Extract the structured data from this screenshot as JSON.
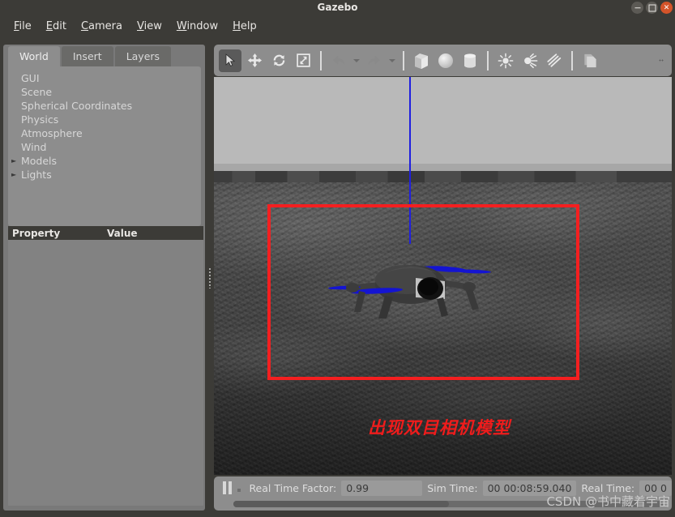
{
  "window": {
    "title": "Gazebo",
    "controls": [
      {
        "name": "minimize-button",
        "icon": "minimize-icon"
      },
      {
        "name": "maximize-button",
        "icon": "maximize-icon"
      },
      {
        "name": "close-button",
        "icon": "close-icon"
      }
    ]
  },
  "menubar": {
    "items": [
      {
        "label": "File",
        "mnemonic": "F",
        "rest": "ile"
      },
      {
        "label": "Edit",
        "mnemonic": "E",
        "rest": "dit"
      },
      {
        "label": "Camera",
        "mnemonic": "C",
        "rest": "amera"
      },
      {
        "label": "View",
        "mnemonic": "V",
        "rest": "iew"
      },
      {
        "label": "Window",
        "mnemonic": "W",
        "rest": "indow"
      },
      {
        "label": "Help",
        "mnemonic": "H",
        "rest": "elp"
      }
    ]
  },
  "left_panel": {
    "tabs": [
      {
        "label": "World",
        "active": true
      },
      {
        "label": "Insert",
        "active": false
      },
      {
        "label": "Layers",
        "active": false
      }
    ],
    "tree": [
      {
        "label": "GUI",
        "expandable": false
      },
      {
        "label": "Scene",
        "expandable": false
      },
      {
        "label": "Spherical Coordinates",
        "expandable": false
      },
      {
        "label": "Physics",
        "expandable": false
      },
      {
        "label": "Atmosphere",
        "expandable": false
      },
      {
        "label": "Wind",
        "expandable": false
      },
      {
        "label": "Models",
        "expandable": true
      },
      {
        "label": "Lights",
        "expandable": true
      }
    ],
    "property_table": {
      "columns": [
        "Property",
        "Value"
      ],
      "rows": []
    }
  },
  "toolbar": {
    "tools": [
      {
        "name": "select-tool",
        "icon": "cursor-arrow-icon",
        "active": true
      },
      {
        "name": "translate-tool",
        "icon": "move-arrows-icon",
        "active": false
      },
      {
        "name": "rotate-tool",
        "icon": "rotate-icon",
        "active": false
      },
      {
        "name": "scale-tool",
        "icon": "scale-icon",
        "active": false
      },
      {
        "name": "undo-button",
        "icon": "undo-arrow-icon",
        "active": false
      },
      {
        "name": "undo-history-dropdown",
        "icon": "chevron-down-icon",
        "active": false
      },
      {
        "name": "redo-button",
        "icon": "redo-arrow-icon",
        "active": false
      },
      {
        "name": "redo-history-dropdown",
        "icon": "chevron-down-icon",
        "active": false
      },
      {
        "name": "insert-box-button",
        "icon": "box-icon",
        "active": false
      },
      {
        "name": "insert-sphere-button",
        "icon": "sphere-icon",
        "active": false
      },
      {
        "name": "insert-cylinder-button",
        "icon": "cylinder-icon",
        "active": false
      },
      {
        "name": "point-light-button",
        "icon": "point-light-icon",
        "active": false
      },
      {
        "name": "spot-light-button",
        "icon": "spot-light-icon",
        "active": false
      },
      {
        "name": "directional-light-button",
        "icon": "directional-light-icon",
        "active": false
      },
      {
        "name": "copy-button",
        "icon": "copy-pages-icon",
        "active": false
      },
      {
        "name": "toolbar-overflow",
        "icon": "overflow-dots-icon",
        "active": false
      }
    ]
  },
  "viewport": {
    "annotation_text": "出现双目相机模型",
    "annotation_color": "#ef1c1c",
    "selection_rect_color": "#f41f20",
    "axis_line_color": "#1f1fe0",
    "sky_color": "#b9b9b9",
    "ground_color": "#454545",
    "model_name": "quadcopter-drone",
    "propeller_color": "#1414d2"
  },
  "statusbar": {
    "pause_label": "pause-button",
    "step_label": "step-button",
    "real_time_factor_label": "Real Time Factor:",
    "real_time_factor_value": "0.99",
    "sim_time_label": "Sim Time:",
    "sim_time_value": "00 00:08:59.040",
    "real_time_label": "Real Time:",
    "real_time_value": "00 0",
    "watermark": "CSDN @书中藏着宇宙"
  }
}
